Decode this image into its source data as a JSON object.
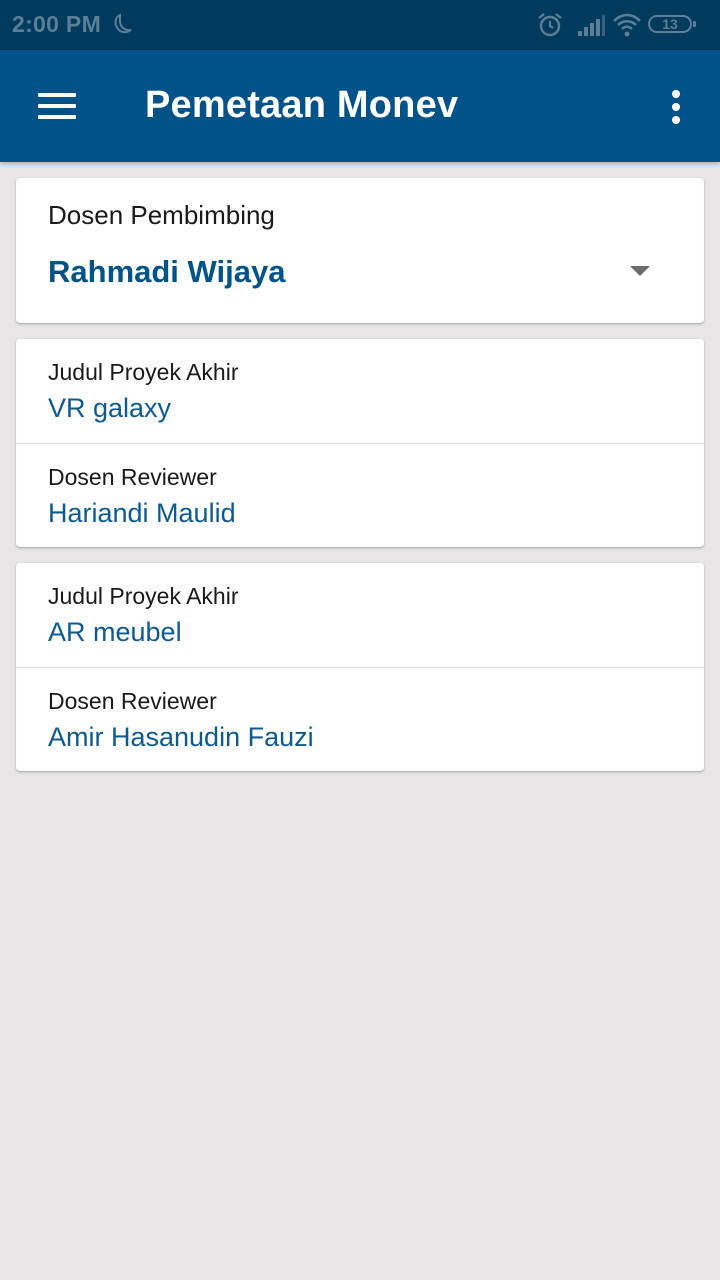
{
  "status_bar": {
    "time": "2:00 PM",
    "battery": "13",
    "icons": [
      "moon-icon",
      "alarm-icon",
      "signal-icon",
      "wifi-icon",
      "battery-icon"
    ]
  },
  "app_bar": {
    "title": "Pemetaan Monev",
    "menu_icon": "hamburger-menu-icon",
    "overflow_icon": "more-vert-icon"
  },
  "dosen_selector": {
    "label": "Dosen Pembimbing",
    "selected": "Rahmadi Wijaya"
  },
  "projects": [
    {
      "title_label": "Judul Proyek Akhir",
      "title": "VR galaxy",
      "reviewer_label": "Dosen Reviewer",
      "reviewer": "Hariandi Maulid"
    },
    {
      "title_label": "Judul Proyek Akhir",
      "title": "AR meubel",
      "reviewer_label": "Dosen Reviewer",
      "reviewer": "Amir Hasanudin Fauzi"
    }
  ],
  "colors": {
    "status_bar": "#003a5c",
    "app_bar": "#005289",
    "accent_text": "#005289",
    "background": "#e8e6e7"
  }
}
